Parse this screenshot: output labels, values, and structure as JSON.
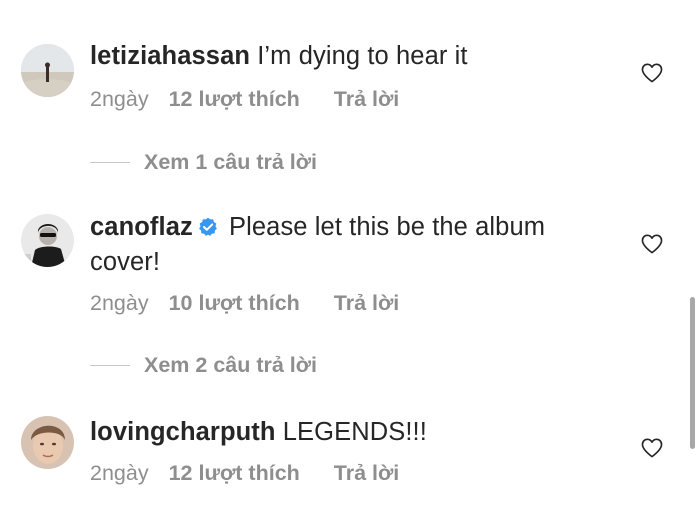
{
  "comments": [
    {
      "username": "letiziahassan",
      "verified": false,
      "text": "I’m dying to hear it",
      "time": "2ngày",
      "likes": "12 lượt thích",
      "reply": "Trả lời",
      "view_replies": "Xem 1 câu trả lời"
    },
    {
      "username": "canoflaz",
      "verified": true,
      "text": "Please let this be the album cover!",
      "time": "2ngày",
      "likes": "10 lượt thích",
      "reply": "Trả lời",
      "view_replies": "Xem 2 câu trả lời"
    },
    {
      "username": "lovingcharputh",
      "verified": false,
      "text": "LEGENDS!!!",
      "time": "2ngày",
      "likes": "12 lượt thích",
      "reply": "Trả lời"
    }
  ],
  "colors": {
    "text": "#262626",
    "muted": "#8e8e8e",
    "verified_badge": "#3897f0"
  },
  "icons": {
    "like": "heart-outline-icon",
    "verified": "verified-badge-icon"
  }
}
